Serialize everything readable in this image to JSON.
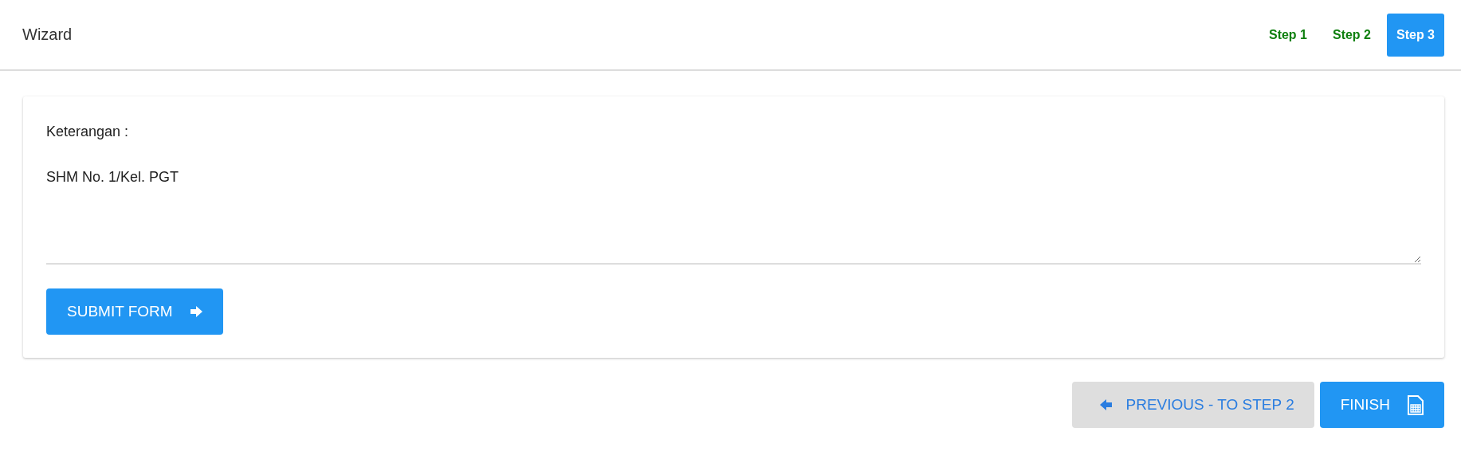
{
  "header": {
    "title": "Wizard"
  },
  "steps": [
    {
      "label": "Step 1",
      "selected": false
    },
    {
      "label": "Step 2",
      "selected": false
    },
    {
      "label": "Step 3",
      "selected": true
    }
  ],
  "form": {
    "label": "Keterangan :",
    "value": "SHM No. 1/Kel. PGT",
    "submit": "SUBMIT FORM"
  },
  "footer": {
    "previous": "PREVIOUS - TO STEP 2",
    "finish": "FINISH"
  }
}
